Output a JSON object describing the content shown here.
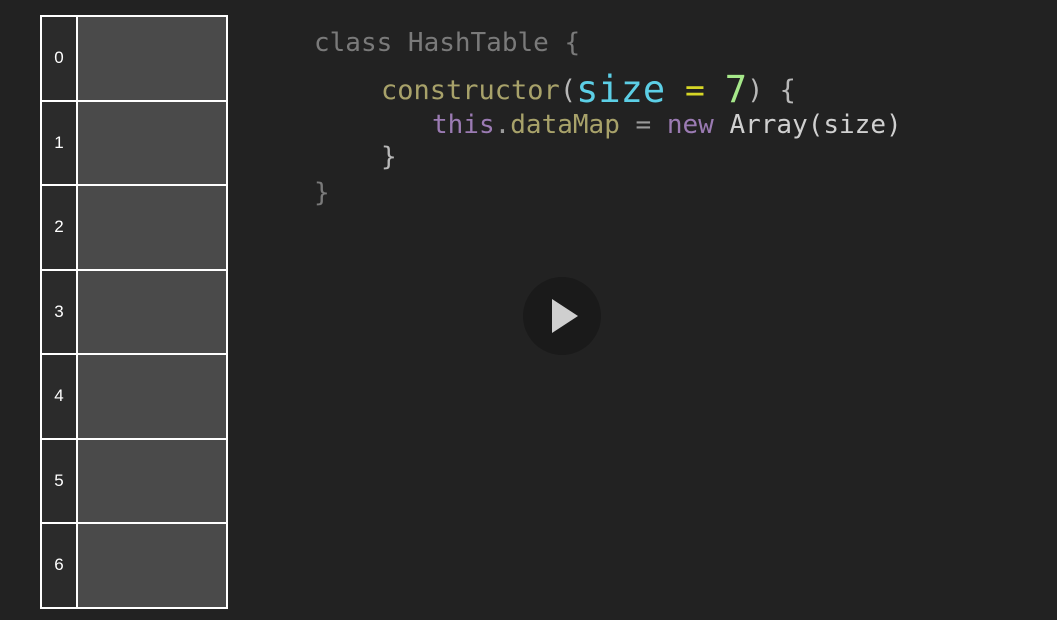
{
  "hash_table": {
    "indices": [
      "0",
      "1",
      "2",
      "3",
      "4",
      "5",
      "6"
    ]
  },
  "code": {
    "line1": "class HashTable {",
    "line2": {
      "fn": "constructor",
      "open_paren": "(",
      "param": "size",
      "op": " = ",
      "num": "7",
      "close": ") {"
    },
    "line3": {
      "this": "this",
      "dot": ".",
      "prop": "dataMap",
      "eq": " = ",
      "new": "new",
      "rest": " Array(size)"
    },
    "line4": "}",
    "line5": "}"
  },
  "player": {
    "play_icon": "play-icon"
  },
  "colors": {
    "background": "#222222",
    "table_border": "#ffffff",
    "table_cell": "#4a4a4a",
    "param": "#5ccfe6",
    "operator": "#d7d726",
    "number": "#a6e88a",
    "keyword": "#9b7bb3",
    "function": "#a8a26a"
  }
}
